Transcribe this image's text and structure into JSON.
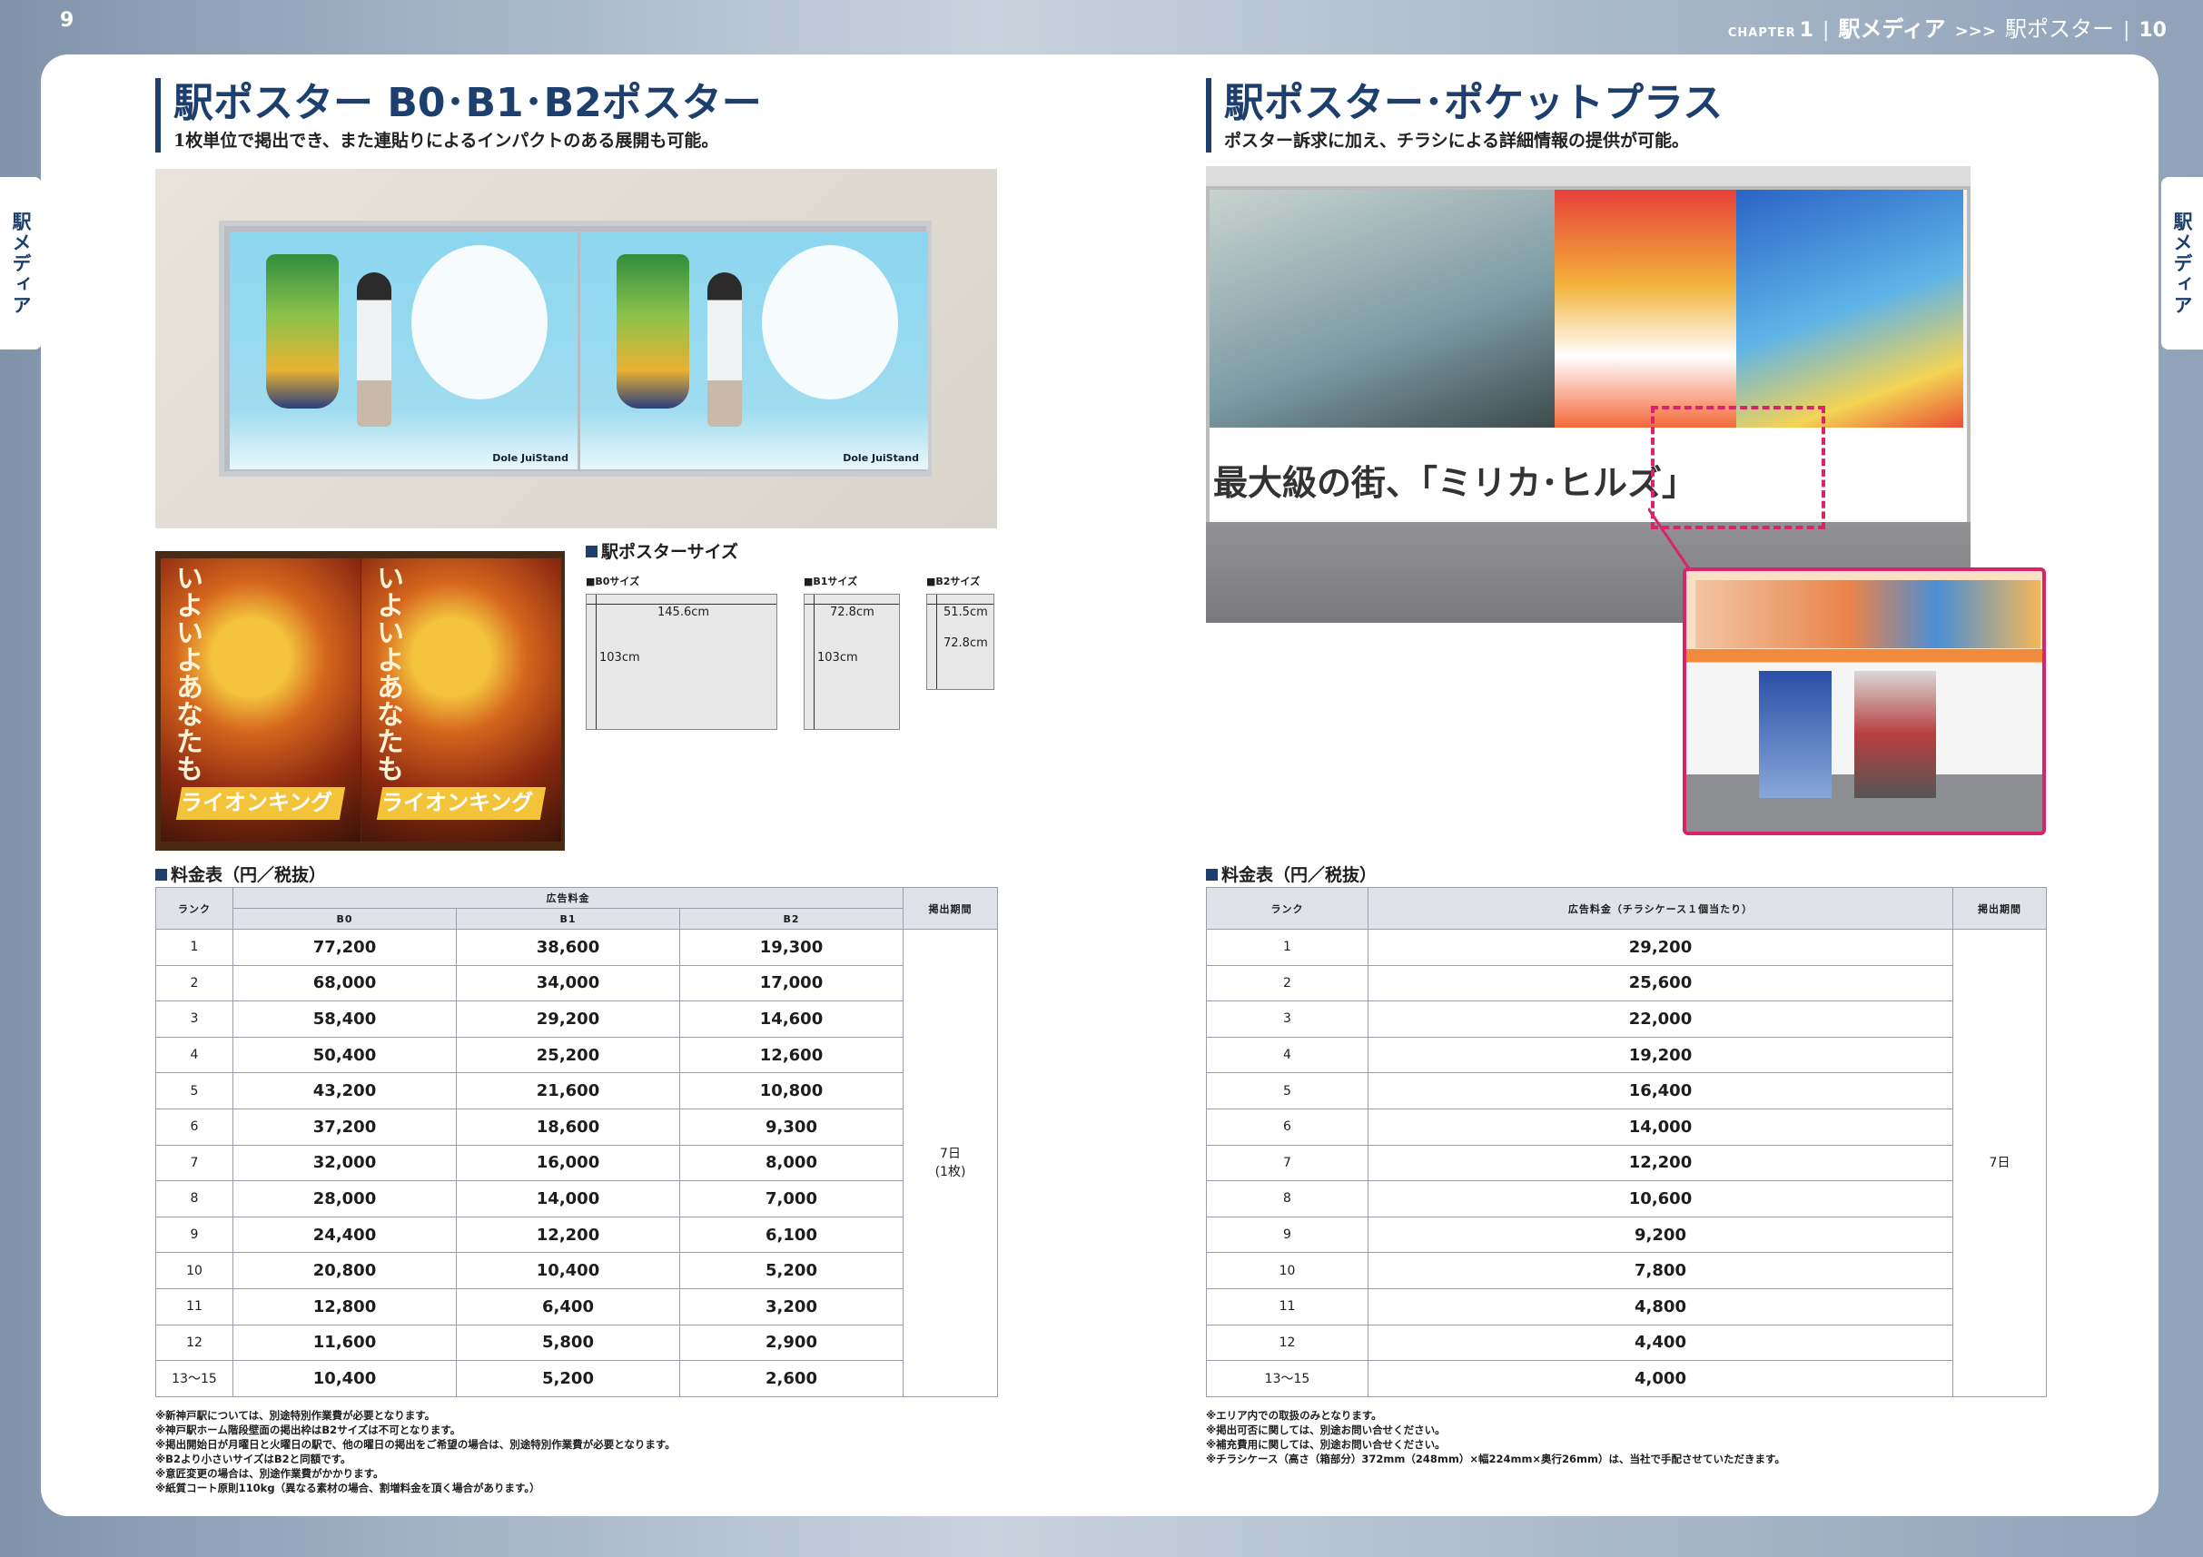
{
  "header": {
    "left_page_number": "9",
    "chapter_word": "CHAPTER",
    "chapter_number": "1",
    "category": "駅メディア",
    "arrows": ">>>",
    "subcategory": "駅ポスター",
    "right_page_number": "10"
  },
  "side_tab": {
    "label": "駅メディア"
  },
  "left": {
    "title": "駅ポスター B0･B1･B2ポスター",
    "subtitle": "1枚単位で掲出でき、また連貼りによるインパクトのある展開も可能。",
    "photo_texts": {
      "dole_brand": "Dole JuiStand",
      "lion_title": "ライオンキング",
      "lion_copy": "いよいよあなたも"
    },
    "size_section": {
      "title": "駅ポスターサイズ",
      "b0": {
        "label": "■B0サイズ",
        "width": "145.6cm",
        "height": "103cm"
      },
      "b1": {
        "label": "■B1サイズ",
        "width": "72.8cm",
        "height": "103cm"
      },
      "b2": {
        "label": "■B2サイズ",
        "width": "51.5cm",
        "height": "72.8cm"
      }
    },
    "price_table": {
      "title": "料金表（円／税抜）",
      "headers": {
        "rank": "ランク",
        "ad_fee": "広告料金",
        "b0": "B0",
        "b1": "B1",
        "b2": "B2",
        "period": "掲出期間"
      },
      "rows": [
        {
          "rank": "1",
          "b0": "77,200",
          "b1": "38,600",
          "b2": "19,300"
        },
        {
          "rank": "2",
          "b0": "68,000",
          "b1": "34,000",
          "b2": "17,000"
        },
        {
          "rank": "3",
          "b0": "58,400",
          "b1": "29,200",
          "b2": "14,600"
        },
        {
          "rank": "4",
          "b0": "50,400",
          "b1": "25,200",
          "b2": "12,600"
        },
        {
          "rank": "5",
          "b0": "43,200",
          "b1": "21,600",
          "b2": "10,800"
        },
        {
          "rank": "6",
          "b0": "37,200",
          "b1": "18,600",
          "b2": "9,300"
        },
        {
          "rank": "7",
          "b0": "32,000",
          "b1": "16,000",
          "b2": "8,000"
        },
        {
          "rank": "8",
          "b0": "28,000",
          "b1": "14,000",
          "b2": "7,000"
        },
        {
          "rank": "9",
          "b0": "24,400",
          "b1": "12,200",
          "b2": "6,100"
        },
        {
          "rank": "10",
          "b0": "20,800",
          "b1": "10,400",
          "b2": "5,200"
        },
        {
          "rank": "11",
          "b0": "12,800",
          "b1": "6,400",
          "b2": "3,200"
        },
        {
          "rank": "12",
          "b0": "11,600",
          "b1": "5,800",
          "b2": "2,900"
        },
        {
          "rank": "13～15",
          "b0": "10,400",
          "b1": "5,200",
          "b2": "2,600"
        }
      ],
      "period_line1": "7日",
      "period_line2": "(1枚)"
    },
    "notes": [
      "※新神戸駅については、別途特別作業費が必要となります。",
      "※神戸駅ホーム階段壁面の掲出枠はB2サイズは不可となります。",
      "※掲出開始日が月曜日と火曜日の駅で、他の曜日の掲出をご希望の場合は、別途特別作業費が必要となります。",
      "※B2より小さいサイズはB2と同額です。",
      "※意匠変更の場合は、別途作業費がかかります。",
      "※紙質コート原則110kg（異なる素材の場合、割増料金を頂く場合があります。）"
    ]
  },
  "right": {
    "title": "駅ポスター･ポケットプラス",
    "subtitle": "ポスター訴求に加え、チラシによる詳細情報の提供が可能。",
    "photo_texts": {
      "banner_copy": "最大級の街、「ミリカ･ヒルズ」"
    },
    "price_table": {
      "title": "料金表（円／税抜）",
      "headers": {
        "rank": "ランク",
        "ad_fee": "広告料金（チラシケース１個当たり）",
        "period": "掲出期間"
      },
      "rows": [
        {
          "rank": "1",
          "fee": "29,200"
        },
        {
          "rank": "2",
          "fee": "25,600"
        },
        {
          "rank": "3",
          "fee": "22,000"
        },
        {
          "rank": "4",
          "fee": "19,200"
        },
        {
          "rank": "5",
          "fee": "16,400"
        },
        {
          "rank": "6",
          "fee": "14,000"
        },
        {
          "rank": "7",
          "fee": "12,200"
        },
        {
          "rank": "8",
          "fee": "10,600"
        },
        {
          "rank": "9",
          "fee": "9,200"
        },
        {
          "rank": "10",
          "fee": "7,800"
        },
        {
          "rank": "11",
          "fee": "4,800"
        },
        {
          "rank": "12",
          "fee": "4,400"
        },
        {
          "rank": "13～15",
          "fee": "4,000"
        }
      ],
      "period": "7日"
    },
    "notes": [
      "※エリア内での取扱のみとなります。",
      "※掲出可否に関しては、別途お問い合せください。",
      "※補充費用に関しては、別途お問い合せください。",
      "※チラシケース（高さ（箱部分）372mm（248mm）×幅224mm×奥行26mm）は、当社で手配させていただきます。"
    ]
  }
}
